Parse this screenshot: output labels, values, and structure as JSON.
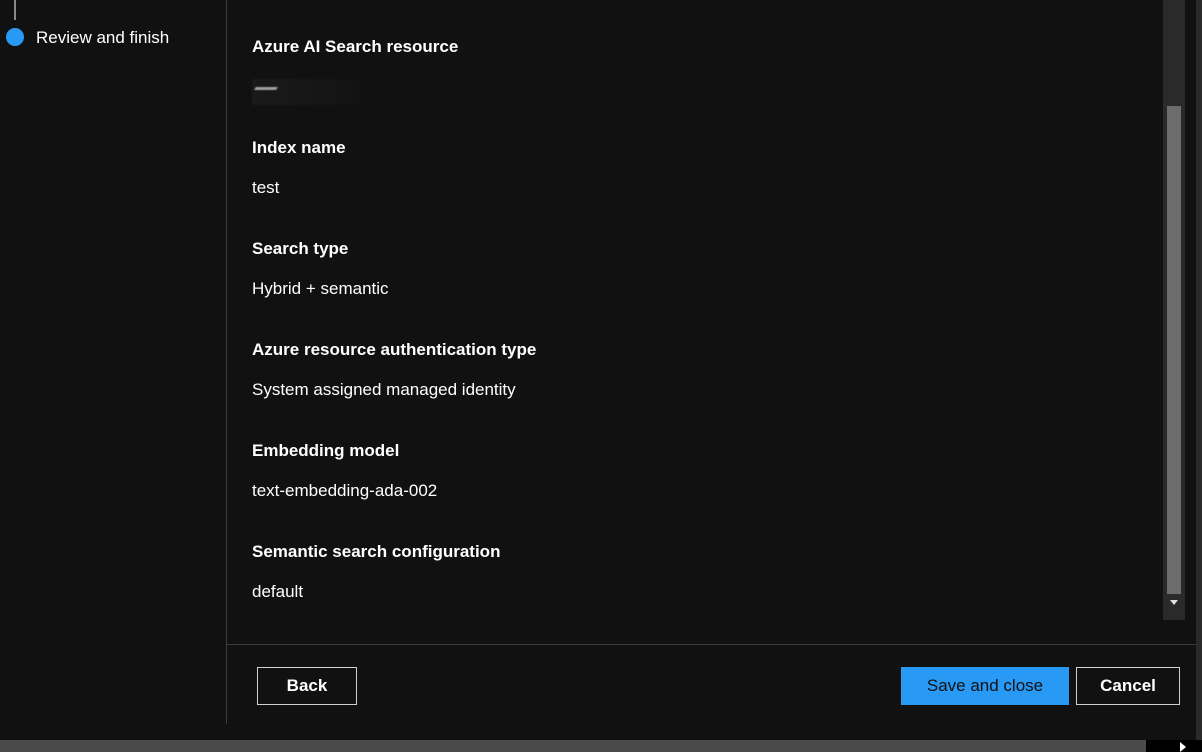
{
  "nav": {
    "current_step": "Review and finish",
    "accent_color": "#2899f5"
  },
  "review": {
    "fields": [
      {
        "label": "Azure AI Search resource",
        "value": ""
      },
      {
        "label": "Index name",
        "value": "test"
      },
      {
        "label": "Search type",
        "value": "Hybrid + semantic"
      },
      {
        "label": "Azure resource authentication type",
        "value": "System assigned managed identity"
      },
      {
        "label": "Embedding model",
        "value": "text-embedding-ada-002"
      },
      {
        "label": "Semantic search configuration",
        "value": "default"
      }
    ]
  },
  "footer": {
    "back_label": "Back",
    "save_label": "Save and close",
    "cancel_label": "Cancel"
  }
}
